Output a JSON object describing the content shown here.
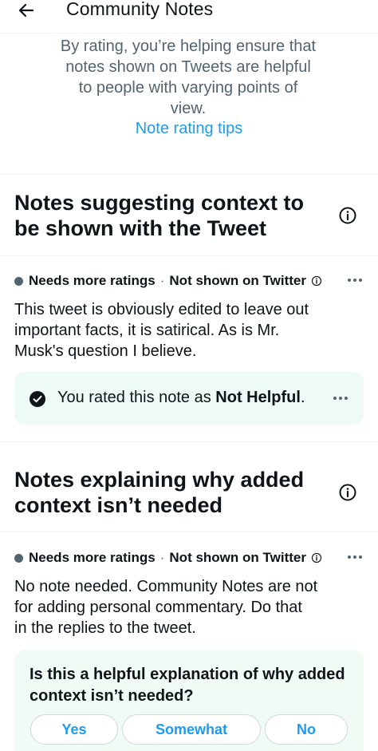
{
  "header": {
    "title": "Community Notes",
    "back_icon": "arrow-left-icon"
  },
  "intro": {
    "lines": [
      "By rating, you’re helping ensure that",
      "notes shown on Tweets are helpful",
      "to people with varying points of",
      "view."
    ],
    "tips_link": "Note rating tips"
  },
  "sections": [
    {
      "title_lines": [
        "Notes suggesting context to",
        "be shown with the Tweet"
      ],
      "info_icon": "info-icon",
      "note": {
        "status": "Needs more ratings",
        "separator": "·",
        "visibility": "Not shown on Twitter",
        "text_lines": [
          "This tweet is obviously edited to leave out",
          "important facts, it is satirical. As is Mr.",
          "Musk's question I believe."
        ],
        "rating": {
          "prefix": "You rated this note as ",
          "value": "Not Helpful",
          "suffix": "."
        }
      }
    },
    {
      "title_lines": [
        "Notes explaining why added",
        "context isn’t needed"
      ],
      "info_icon": "info-icon",
      "note": {
        "status": "Needs more ratings",
        "separator": "·",
        "visibility": "Not shown on Twitter",
        "text_lines": [
          "No note needed. Community Notes are not",
          "for adding personal commentary. Do that",
          "in the replies to the tweet."
        ],
        "question_lines": [
          "Is this a helpful explanation of why added",
          "context isn’t needed?"
        ],
        "options": [
          "Yes",
          "Somewhat",
          "No"
        ]
      }
    }
  ],
  "colors": {
    "link": "#1d9bf0",
    "secondary_text": "#536471",
    "rated_box_bg": "#eefaf5",
    "divider": "#eff3f4"
  }
}
